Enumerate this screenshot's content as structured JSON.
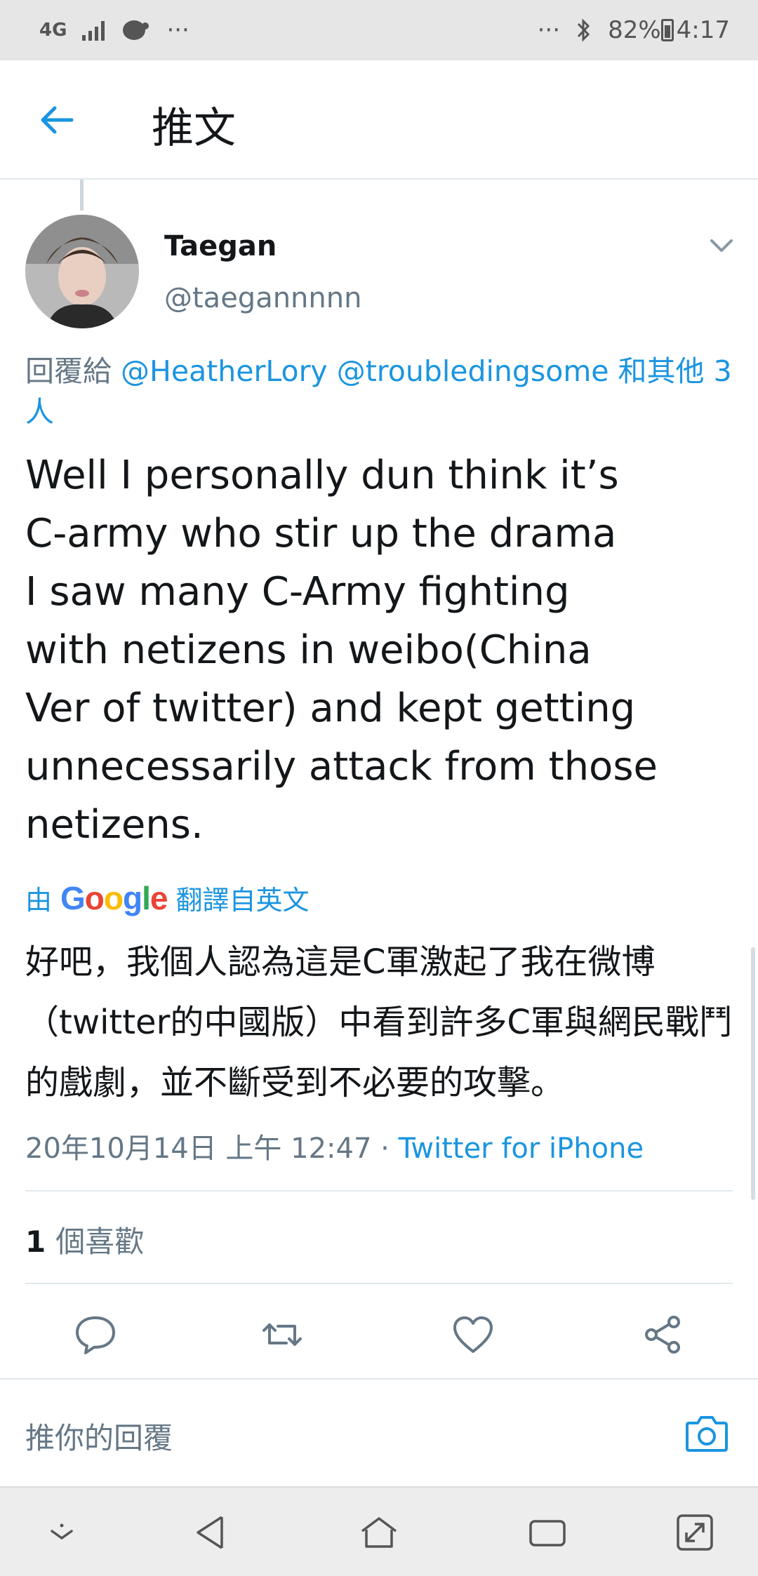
{
  "status_bar": {
    "network": "4G",
    "more": "···",
    "more_right": "···",
    "battery": "82%",
    "time": "4:17"
  },
  "header": {
    "title": "推文"
  },
  "tweet": {
    "author_name": "Taegan",
    "author_handle": "@taegannnnn",
    "reply_prefix": "回覆給",
    "reply_users": "@HeatherLory @troubledingsome 和其他 3 人",
    "text": "Well I personally dun think it’s\nC-army who stir up the drama\nI saw many C-Army fighting\nwith netizens in weibo(China\nVer of twitter) and kept getting\nunnecessarily attack from those\nnetizens.",
    "translate_prefix": "由",
    "translate_brand": "Google",
    "translate_suffix": "翻譯自英文",
    "translated_text": "好吧，我個人認為這是C軍激起了我在微博（twitter的中國版）中看到許多C軍與網民戰鬥的戲劇，並不斷受到不必要的攻擊。",
    "timestamp": "20年10月14日 上午 12:47",
    "separator": " · ",
    "source": "Twitter for iPhone",
    "likes_count": "1",
    "likes_label": "個喜歡"
  },
  "reply_box": {
    "placeholder": "推你的回覆"
  },
  "icons": {
    "back": "arrow-left-icon",
    "chevron": "chevron-down-icon",
    "reply": "comment-icon",
    "retweet": "retweet-icon",
    "like": "heart-icon",
    "share": "share-icon",
    "camera": "camera-icon"
  },
  "colors": {
    "accent": "#1b95e0",
    "text": "#14171a",
    "secondary": "#657786",
    "divider": "#e1e8ed"
  }
}
